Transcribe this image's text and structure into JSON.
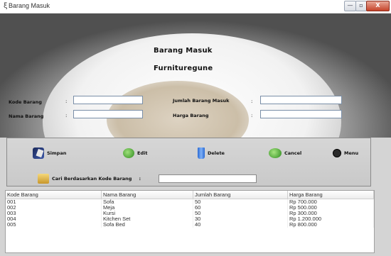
{
  "window": {
    "title": "Barang Masuk",
    "minimize_glyph": "—",
    "maximize_glyph": "▫",
    "close_glyph": "X",
    "icon": "app-icon"
  },
  "header": {
    "title": "Barang Masuk",
    "subtitle": "Furnituregune"
  },
  "form": {
    "kode_label": "Kode Barang",
    "nama_label": "Nama Barang",
    "jumlah_label": "Jumlah Barang Masuk",
    "harga_label": "Harga Barang",
    "colon": ":",
    "kode_value": "",
    "nama_value": "",
    "jumlah_value": "",
    "harga_value": ""
  },
  "actions": {
    "save": "Simpan",
    "edit": "Edit",
    "delete": "Delete",
    "cancel": "Cancel",
    "menu": "Menu"
  },
  "search": {
    "label": "Cari Berdasarkan Kode Barang",
    "colon": ":",
    "value": ""
  },
  "table": {
    "columns": [
      "Kode Barang",
      "Nama Barang",
      "Jumlah Barang",
      "Harga Barang"
    ],
    "rows": [
      [
        "001",
        "Sofa",
        "50",
        "Rp 700.000"
      ],
      [
        "002",
        "Meja",
        "60",
        "Rp 500.000"
      ],
      [
        "003",
        "Kursi",
        "50",
        "Rp 300.000"
      ],
      [
        "004",
        "Kitchen Set",
        "30",
        "Rp 1.200.000"
      ],
      [
        "005",
        "Sofa Bed",
        "40",
        "Rp 800.000"
      ]
    ]
  }
}
